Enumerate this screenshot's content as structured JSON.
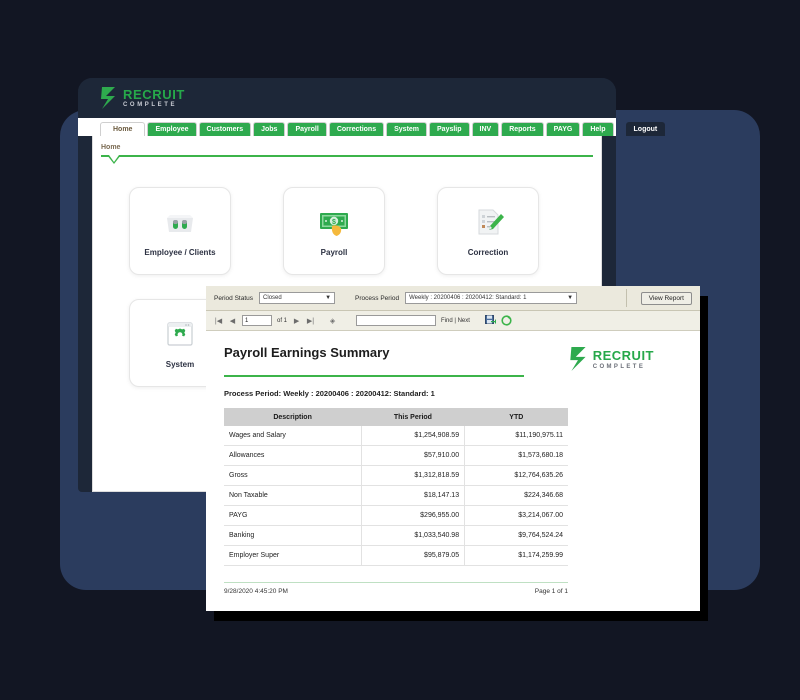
{
  "app": {
    "logo": {
      "main": "RECRUIT",
      "sub": "COMPLETE",
      "mark": "recruit-complete-logo-icon"
    },
    "nav_tabs": [
      {
        "label": "Home",
        "active": true
      },
      {
        "label": "Employee",
        "active": false
      },
      {
        "label": "Customers",
        "active": false
      },
      {
        "label": "Jobs",
        "active": false
      },
      {
        "label": "Payroll",
        "active": false
      },
      {
        "label": "Corrections",
        "active": false
      },
      {
        "label": "System",
        "active": false
      },
      {
        "label": "Payslip",
        "active": false
      },
      {
        "label": "INV",
        "active": false
      },
      {
        "label": "Reports",
        "active": false
      },
      {
        "label": "PAYG",
        "active": false
      },
      {
        "label": "Help",
        "active": false
      }
    ],
    "logout_label": "Logout",
    "breadcrumb": "Home",
    "tiles": [
      {
        "label": "Employee / Clients",
        "icon": "people-group-icon"
      },
      {
        "label": "Payroll",
        "icon": "money-cash-icon"
      },
      {
        "label": "Correction",
        "icon": "edit-document-icon"
      },
      {
        "label": "System",
        "icon": "gear-settings-icon"
      }
    ]
  },
  "report_viewer": {
    "toolbar": {
      "period_status_label": "Period Status",
      "period_status_value": "Closed",
      "process_period_label": "Process Period",
      "process_period_value": "Weekly : 20200406 : 20200412: Standard: 1",
      "view_report_label": "View Report"
    },
    "pager": {
      "first_icon": "first-page-icon",
      "prev_icon": "previous-page-icon",
      "page_value": "1",
      "of_label": "of 1",
      "next_icon": "next-page-icon",
      "last_icon": "last-page-icon",
      "back_icon": "back-to-parent-report-icon",
      "find_value": "",
      "find_label": "Find | Next",
      "export_icon": "export-save-icon",
      "refresh_icon": "refresh-icon"
    },
    "report": {
      "title": "Payroll Earnings Summary",
      "logo_main": "RECRUIT",
      "logo_sub": "COMPLETE",
      "process_period": "Process Period: Weekly : 20200406 : 20200412: Standard: 1",
      "columns": [
        "Description",
        "This Period",
        "YTD"
      ],
      "rows": [
        {
          "description": "Wages and Salary",
          "this_period": "$1,254,908.59",
          "ytd": "$11,190,975.11"
        },
        {
          "description": "Allowances",
          "this_period": "$57,910.00",
          "ytd": "$1,573,680.18"
        },
        {
          "description": "Gross",
          "this_period": "$1,312,818.59",
          "ytd": "$12,764,635.26"
        },
        {
          "description": "Non Taxable",
          "this_period": "$18,147.13",
          "ytd": "$224,346.68"
        },
        {
          "description": "PAYG",
          "this_period": "$296,955.00",
          "ytd": "$3,214,067.00"
        },
        {
          "description": "Banking",
          "this_period": "$1,033,540.98",
          "ytd": "$9,764,524.24"
        },
        {
          "description": "Employer Super",
          "this_period": "$95,879.05",
          "ytd": "$1,174,259.99"
        }
      ],
      "footer_timestamp": "9/28/2020 4:45:20 PM",
      "footer_page": "Page 1 of 1"
    }
  },
  "theme": {
    "page_bg": "#121623",
    "plate_navy": "#2b3c5e",
    "header_navy": "#1d2738",
    "accent_green": "#2eaa4e",
    "rule_green": "#3cb44a"
  }
}
